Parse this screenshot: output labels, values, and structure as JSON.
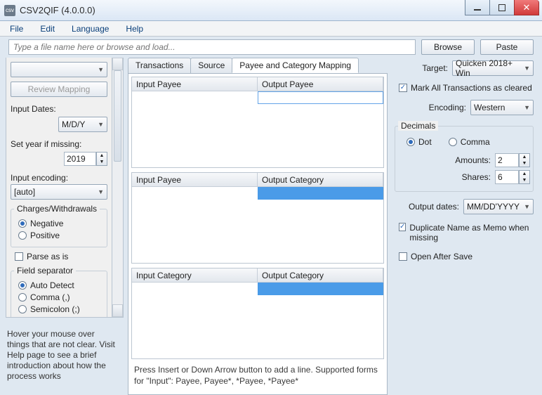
{
  "window": {
    "title": "CSV2QIF (4.0.0.0)",
    "icon_label": "csv/qif"
  },
  "menu": {
    "file": "File",
    "edit": "Edit",
    "language": "Language",
    "help": "Help"
  },
  "file_row": {
    "placeholder": "Type a file name here or browse and load...",
    "browse": "Browse",
    "paste": "Paste"
  },
  "left": {
    "review": "Review Mapping",
    "input_dates_label": "Input Dates:",
    "input_dates_value": "M/D/Y",
    "set_year_label": "Set year if missing:",
    "set_year_value": "2019",
    "input_encoding_label": "Input encoding:",
    "input_encoding_value": "[auto]",
    "charges_legend": "Charges/Withdrawals",
    "neg": "Negative",
    "pos": "Positive",
    "parse_as_is": "Parse as is",
    "field_sep_legend": "Field separator",
    "auto_detect": "Auto Detect",
    "comma": "Comma (,)",
    "semicolon": "Semicolon (;)"
  },
  "tabs": {
    "t1": "Transactions",
    "t2": "Source",
    "t3": "Payee and Category Mapping"
  },
  "grid": {
    "b1c1": "Input Payee",
    "b1c2": "Output Payee",
    "b2c1": "Input Payee",
    "b2c2": "Output Category",
    "b3c1": "Input Category",
    "b3c2": "Output Category",
    "hint": "Press Insert or Down Arrow button to add a line. Supported forms for \"Input\": Payee, Payee*, *Payee, *Payee*"
  },
  "right": {
    "target_label": "Target:",
    "target_value": "Quicken 2018+ Win",
    "mark_all": "Mark All Transactions as cleared",
    "encoding_label": "Encoding:",
    "encoding_value": "Western",
    "decimals_legend": "Decimals",
    "dot": "Dot",
    "comma": "Comma",
    "amounts_label": "Amounts:",
    "amounts_value": "2",
    "shares_label": "Shares:",
    "shares_value": "6",
    "output_dates_label": "Output dates:",
    "output_dates_value": "MM/DD'YYYY",
    "dup_name": "Duplicate Name as Memo when missing",
    "open_after": "Open After Save"
  },
  "help_hover": "Hover your mouse over things that are not clear. Visit Help page to see a brief introduction about how the process works"
}
